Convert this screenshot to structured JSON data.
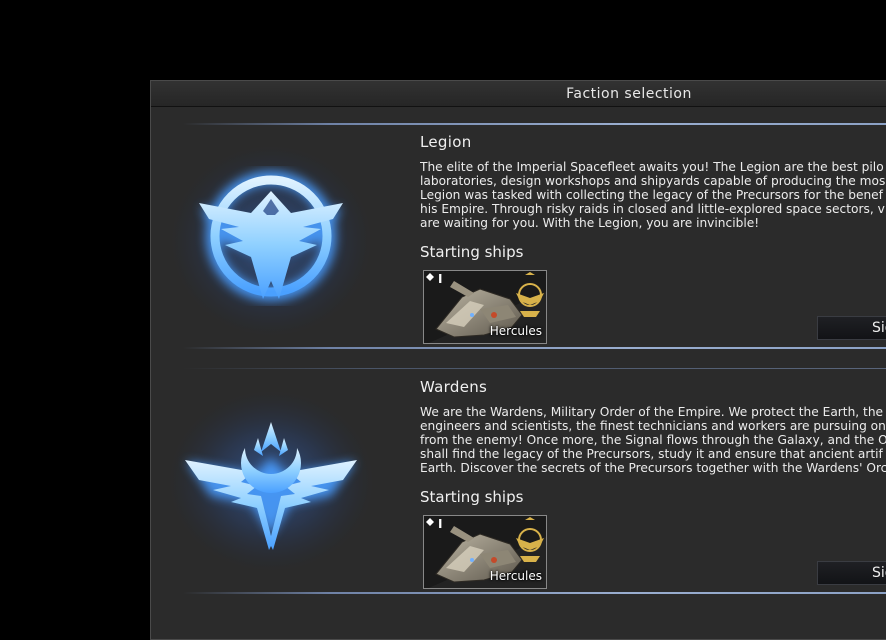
{
  "dialog": {
    "title": "Faction selection"
  },
  "factions": [
    {
      "name": "Legion",
      "description": [
        "The elite of the Imperial Spacefleet awaits you! The Legion are the best pilo",
        "laboratories, design workshops and shipyards capable of producing the mos",
        "Legion was tasked with collecting the legacy of the Precursors for the benef",
        "his Empire. Through risky raids in closed and little-explored space sectors, v",
        "are waiting for you. With the Legion, you are invincible!"
      ],
      "starting_ships_label": "Starting ships",
      "ship": {
        "name": "Hercules",
        "level": "I"
      },
      "button_label": "Sig"
    },
    {
      "name": "Wardens",
      "description": [
        "We are the Wardens, Military Order of the Empire. We protect the Earth, the",
        "engineers and scientists, the finest technicians and workers are pursuing on",
        "from the enemy! Once more, the Signal flows through the Galaxy, and the O",
        "shall find the legacy of the Precursors, study it and ensure that ancient artif",
        "Earth. Discover the secrets of the Precursors together with the Wardens' Orc"
      ],
      "starting_ships_label": "Starting ships",
      "ship": {
        "name": "Hercules",
        "level": "I"
      },
      "button_label": "Sig"
    }
  ],
  "colors": {
    "glow": "#5aa8ff",
    "accent": "#8aa0c4",
    "badge": "#d8b24a"
  }
}
